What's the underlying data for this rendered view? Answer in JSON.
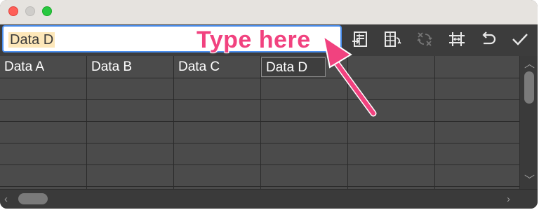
{
  "window": {
    "traffic_lights": [
      {
        "name": "close",
        "color": "#fe5f57"
      },
      {
        "name": "minimize",
        "color": "#cfcdca"
      },
      {
        "name": "zoom",
        "color": "#28c840"
      }
    ]
  },
  "toolbar": {
    "input_value": "Data D",
    "input_focus_color": "#4a8ff0",
    "buttons": [
      {
        "icon": "import-data-icon"
      },
      {
        "icon": "swap-columns-icon"
      },
      {
        "icon": "transpose-icon",
        "disabled": true
      },
      {
        "icon": "cell-size-icon"
      },
      {
        "icon": "undo-icon"
      },
      {
        "icon": "apply-checkmark-icon"
      }
    ]
  },
  "grid": {
    "columns": [
      "Data A",
      "Data B",
      "Data C",
      "Data D",
      "",
      ""
    ],
    "active_column": 3
  },
  "annotation": {
    "text": "Type here",
    "color": "#f1427f"
  }
}
